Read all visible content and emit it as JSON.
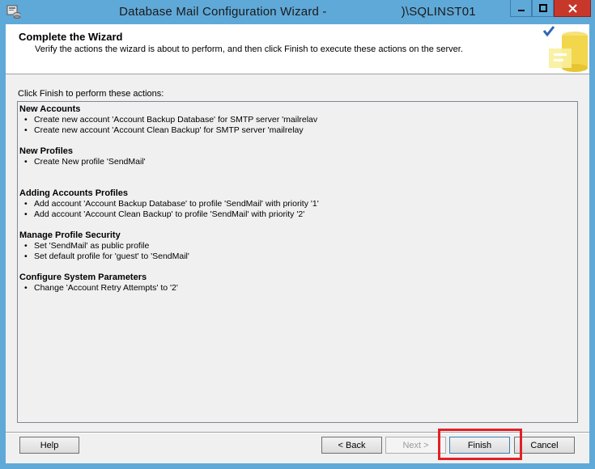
{
  "window": {
    "title_left": "Database Mail Configuration Wizard -",
    "title_right": ")\\SQLINST01"
  },
  "header": {
    "title": "Complete the Wizard",
    "subtitle": "Verify the actions the wizard is about to perform, and then click Finish to execute these actions on the server."
  },
  "instruction": "Click Finish to perform these actions:",
  "sections": [
    {
      "title": "New Accounts",
      "items": [
        "Create new account 'Account Backup Database' for SMTP server 'mailrelav",
        "Create new account 'Account Clean Backup' for SMTP server 'mailrelay"
      ]
    },
    {
      "title": "New Profiles",
      "items": [
        "Create New profile 'SendMail'"
      ]
    },
    {
      "title": "Adding Accounts Profiles",
      "items": [
        "Add account 'Account Backup Database' to profile 'SendMail' with priority '1'",
        "Add account 'Account Clean Backup' to profile 'SendMail' with priority '2'"
      ]
    },
    {
      "title": "Manage Profile Security",
      "items": [
        "Set 'SendMail' as public profile",
        "Set default profile for 'guest' to 'SendMail'"
      ]
    },
    {
      "title": "Configure System Parameters",
      "items": [
        "Change 'Account Retry Attempts' to '2'"
      ]
    }
  ],
  "buttons": {
    "help": "Help",
    "back": "< Back",
    "next": "Next >",
    "finish": "Finish",
    "cancel": "Cancel"
  },
  "icons": {
    "app": "database-mail-icon",
    "header": "wizard-complete-icon",
    "bullet": "•"
  },
  "colors": {
    "titlebar": "#5fa9d8",
    "close_button": "#c7382b",
    "highlight": "#e21f26"
  }
}
